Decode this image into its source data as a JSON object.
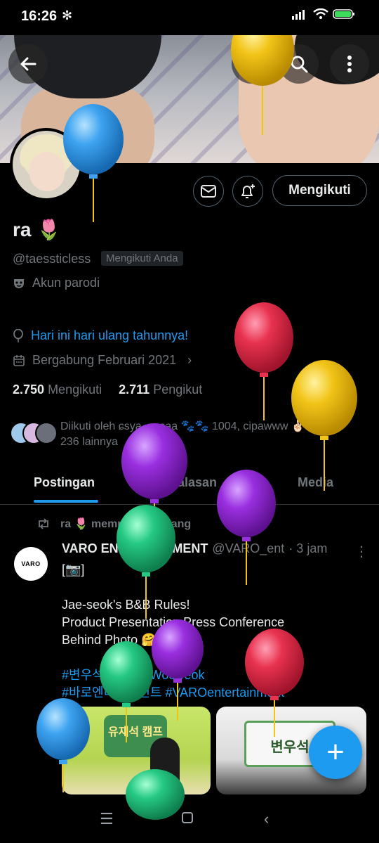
{
  "status_bar": {
    "time": "16:26",
    "signal_icon": "signal-icon",
    "wifi_icon": "wifi-icon",
    "battery_icon": "battery-icon"
  },
  "header": {
    "back_icon": "arrow-left-icon",
    "grok_icon": "grok-icon",
    "search_icon": "search-icon",
    "more_icon": "more-vertical-icon"
  },
  "profile": {
    "name": "ra 🌷",
    "handle": "@taessticless",
    "follows_you_badge": "Mengikuti Anda",
    "parody_label": "Akun parodi",
    "birthday_text": "Hari ini hari ulang tahunnya!",
    "joined_text": "Bergabung Februari 2021",
    "following_count": "2.750",
    "following_label": "Mengikuti",
    "followers_count": "2.711",
    "followers_label": "Pengikut",
    "followed_by_text": "Diikuti oleh ɕsya, sasaa 🐾🐾 1004, cipawww ✌🏻✌🏻 dan 236 lainnya",
    "follow_button_label": "Mengikuti"
  },
  "tabs": [
    {
      "label": "Postingan",
      "active": true
    },
    {
      "label": "Balasan",
      "active": false
    },
    {
      "label": "Media",
      "active": false
    }
  ],
  "post": {
    "repost_text": "ra 🌷 memposting ulang",
    "avatar_text": "VARO",
    "author_name": "VARO ENTERTAINMENT",
    "author_handle": "@VARO_ent",
    "time": "· 3 jam",
    "line1": "[📷]",
    "line2": "Jae-seok's B&B Rules!",
    "line3": "Product Presentation Press Conference",
    "line4": "Behind Photo 🤗📷",
    "hashtags1": "#변우석 #ByeonWooSeok",
    "hashtags2": "#바로엔터테인먼트 #VAROentertainment",
    "media1_text": "유재석 캠프",
    "media2_text": "변우석"
  },
  "fab_label": "+",
  "colors": {
    "accent": "#1d9bf0",
    "background": "#000000",
    "muted": "#71767b",
    "text": "#e7e9ea"
  }
}
